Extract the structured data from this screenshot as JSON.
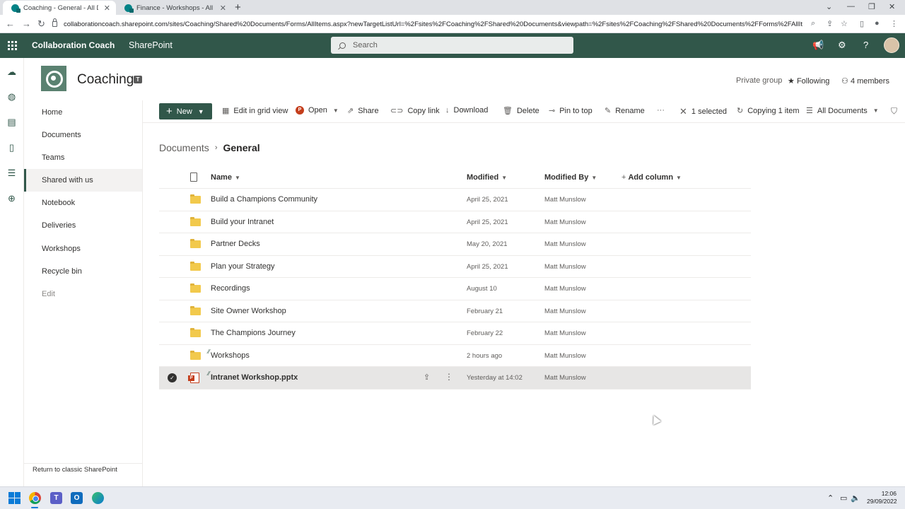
{
  "browser": {
    "tabs": [
      {
        "title": "Coaching - General - All Docume",
        "active": true
      },
      {
        "title": "Finance - Workshops - All Docum",
        "active": false
      }
    ],
    "url": "collaborationcoach.sharepoint.com/sites/Coaching/Shared%20Documents/Forms/AllItems.aspx?newTargetListUrl=%2Fsites%2FCoaching%2FShared%20Documents&viewpath=%2Fsites%2FCoaching%2FShared%20Documents%2FForms%2FAllItems%2Ea..."
  },
  "suite": {
    "brand": "Collaboration Coach",
    "app": "SharePoint",
    "search_placeholder": "Search"
  },
  "site": {
    "title": "Coaching",
    "privacy": "Private group",
    "following": "Following",
    "members": "4 members"
  },
  "nav": {
    "items": [
      "Home",
      "Documents",
      "Teams",
      "Shared with us",
      "Notebook",
      "Deliveries",
      "Workshops",
      "Recycle bin"
    ],
    "selected": "Shared with us",
    "edit": "Edit",
    "classic_link": "Return to classic SharePoint"
  },
  "commands": {
    "new": "New",
    "edit_grid": "Edit in grid view",
    "open": "Open",
    "share": "Share",
    "copy_link": "Copy link",
    "download": "Download",
    "delete": "Delete",
    "pin": "Pin to top",
    "rename": "Rename",
    "more": "···",
    "selected": "1 selected",
    "copying": "Copying 1 item",
    "view": "All Documents"
  },
  "breadcrumb": {
    "root": "Documents",
    "current": "General"
  },
  "list": {
    "columns": {
      "name": "Name",
      "modified": "Modified",
      "modified_by": "Modified By",
      "add_column": "Add column"
    },
    "rows": [
      {
        "name": "Build a Champions Community",
        "modified": "April 25, 2021",
        "by": "Matt Munslow"
      },
      {
        "name": "Build your Intranet",
        "modified": "April 25, 2021",
        "by": "Matt Munslow"
      },
      {
        "name": "Partner Decks",
        "modified": "May 20, 2021",
        "by": "Matt Munslow"
      },
      {
        "name": "Plan your Strategy",
        "modified": "April 25, 2021",
        "by": "Matt Munslow"
      },
      {
        "name": "Recordings",
        "modified": "August 10",
        "by": "Matt Munslow"
      },
      {
        "name": "Site Owner Workshop",
        "modified": "February 21",
        "by": "Matt Munslow"
      },
      {
        "name": "The Champions Journey",
        "modified": "February 22",
        "by": "Matt Munslow"
      },
      {
        "name": "Workshops",
        "modified": "2 hours ago",
        "by": "Matt Munslow"
      },
      {
        "name": "Intranet Workshop.pptx",
        "modified": "Yesterday at 14:02",
        "by": "Matt Munslow"
      }
    ]
  },
  "taskbar": {
    "time": "12:06",
    "date": "29/09/2022"
  },
  "colors": {
    "suite": "#31574a",
    "accent": "#31574a"
  }
}
